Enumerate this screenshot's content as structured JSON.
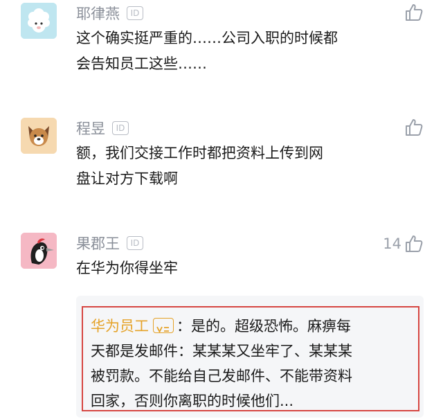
{
  "comments": [
    {
      "username": "耶律燕",
      "id_label": "ID",
      "avatar": "sheep-avatar",
      "lines": [
        "这个确实挺严重的……公司入职的时候都",
        "会告知员工这些……"
      ],
      "likes": ""
    },
    {
      "username": "程昱",
      "id_label": "ID",
      "avatar": "dog-avatar",
      "lines": [
        "额，我们交接工作时都把资料上传到网",
        "盘让对方下载啊"
      ],
      "likes": ""
    },
    {
      "username": "果郡王",
      "id_label": "ID",
      "avatar": "woodpecker-avatar",
      "lines": [
        "在华为你得坐牢"
      ],
      "likes": "14"
    }
  ],
  "reply": {
    "author": "华为员工",
    "first_line": "：是的。超级恐怖。麻痹每",
    "lines": [
      "天都是发邮件：某某某又坐牢了、某某某",
      "被罚款。不能给自己发邮件、不能带资料",
      "回家，否则你离职的时候他们..."
    ]
  },
  "colors": {
    "username": "#8a8f99",
    "reply_author": "#e5a227",
    "highlight_border": "#d64541"
  }
}
